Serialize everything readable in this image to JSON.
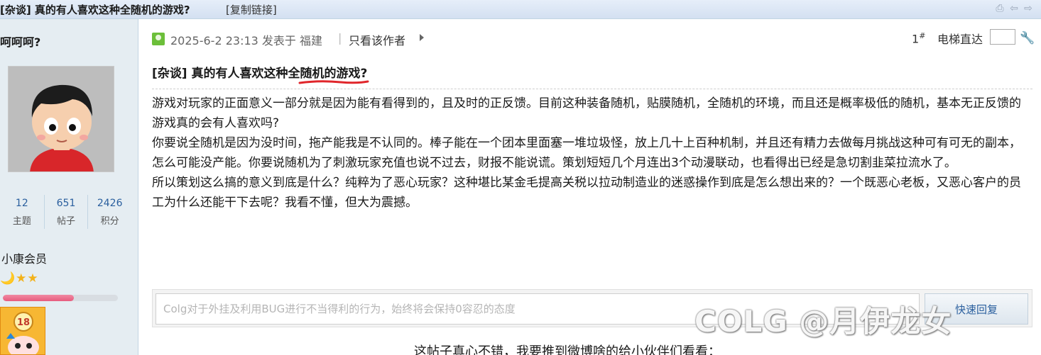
{
  "header": {
    "title": "[杂谈] 真的有人喜欢这种全随机的游戏?",
    "copy_link": "[复制链接]",
    "tool_icons": [
      "print-icon",
      "prev-icon",
      "next-icon"
    ]
  },
  "user": {
    "name": "呵呵呵?",
    "stats": [
      {
        "value": "12",
        "label": "主题"
      },
      {
        "value": "651",
        "label": "帖子"
      },
      {
        "value": "2426",
        "label": "积分"
      }
    ],
    "group": "小康会员",
    "stars": "🌙★★",
    "progress": 0.62,
    "medal_badge": "18"
  },
  "post": {
    "date_text": "2025-6-2 23:13 发表于 福建",
    "separator": "|",
    "author_only": "只看该作者",
    "floor": "1",
    "floor_mark": "#",
    "elevator": "电梯直达",
    "title": "[杂谈] 真的有人喜欢这种全随机的游戏?",
    "paragraphs": [
      "游戏对玩家的正面意义一部分就是因为能有看得到的，且及时的正反馈。目前这种装备随机，贴膜随机，全随机的环境，而且还是概率极低的随机，基本无正反馈的游戏真的会有人喜欢吗?",
      "你要说全随机是因为没时间，拖产能我是不认同的。棒子能在一个团本里面塞一堆垃圾怪，放上几十上百种机制，并且还有精力去做每月挑战这种可有可无的副本，怎么可能没产能。你要说随机为了刺激玩家充值也说不过去，财报不能说谎。策划短短几个月连出3个动漫联动，也看得出已经是急切割韭菜拉流水了。",
      "所以策划这么搞的意义到底是什么？纯粹为了恶心玩家？这种堪比某金毛提高关税以拉动制造业的迷惑操作到底是怎么想出来的？一个既恶心老板，又恶心客户的员工为什么还能干下去呢？我看不懂，但大为震撼。"
    ]
  },
  "reply": {
    "placeholder": "Colg对于外挂及利用BUG进行不当得利的行为，始终将会保持0容忍的态度",
    "button": "快速回复"
  },
  "share_text": "这帖子真心不错，我要推到微博啥的给小伙伴们看看：",
  "watermark": "COLG @月伊龙女",
  "colors": {
    "sidebar_bg": "#e5edf2",
    "link_blue": "#2a5f9e",
    "underline_red": "#e0262b",
    "progress_pink": "#e85b7e"
  }
}
